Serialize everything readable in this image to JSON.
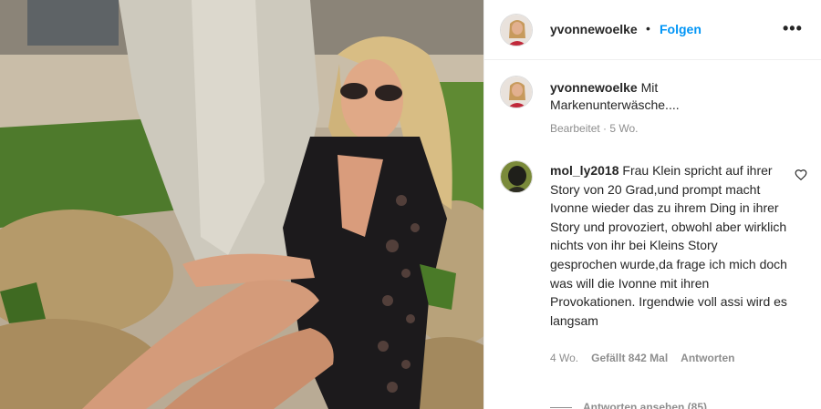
{
  "post": {
    "username": "yvonnewoelke",
    "separator": "•",
    "follow_label": "Folgen",
    "more_label": "•••",
    "caption_username": "yvonnewoelke",
    "caption_text": "Mit Markenunterwäsche....",
    "caption_meta": "Bearbeitet · 5 Wo."
  },
  "comment": {
    "username": "mol_ly2018",
    "text": "Frau Klein spricht auf ihrer Story von 20 Grad,und prompt macht Ivonne wieder das zu ihrem Ding in ihrer Story und provoziert, obwohl aber wirklich nichts von ihr bei Kleins Story gesprochen wurde,da frage ich mich doch was will die Ivonne mit ihren Provokationen. Irgendwie voll assi wird es langsam",
    "age": "4 Wo.",
    "likes": "Gefällt 842 Mal",
    "reply_label": "Antworten",
    "view_replies": "Antworten ansehen (85)"
  },
  "colors": {
    "accent": "#0095f6",
    "muted": "#8e8e8e"
  },
  "icons": {
    "more": "more-horizontal-icon",
    "heart": "heart-outline-icon"
  }
}
